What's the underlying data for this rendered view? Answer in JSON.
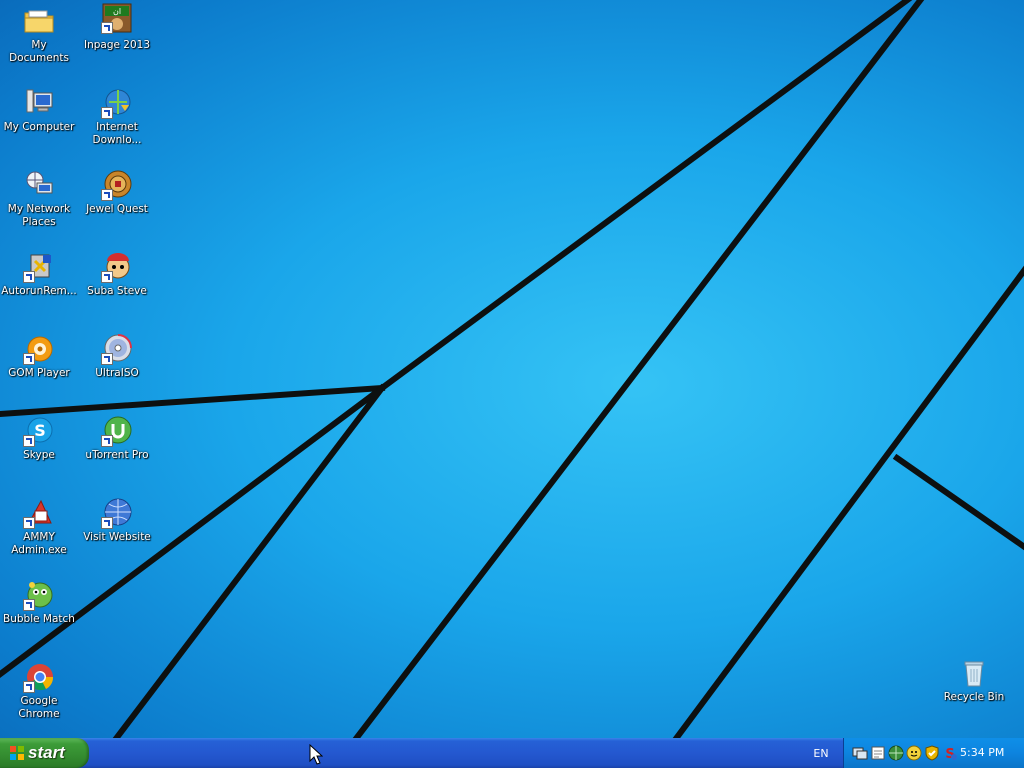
{
  "desktop": {
    "icons": [
      {
        "label": "My Documents",
        "icon": "folder-icon"
      },
      {
        "label": "Inpage 2013",
        "icon": "inpage-icon"
      },
      {
        "label": "My Computer",
        "icon": "computer-icon"
      },
      {
        "label": "Internet Downlo...",
        "icon": "internet-download-manager-icon"
      },
      {
        "label": "My Network Places",
        "icon": "network-places-icon"
      },
      {
        "label": "Jewel Quest",
        "icon": "jewel-quest-icon"
      },
      {
        "label": "AutorunRem...",
        "icon": "autorun-remover-icon"
      },
      {
        "label": "Suba Steve",
        "icon": "suba-steve-icon"
      },
      {
        "label": "GOM Player",
        "icon": "gom-player-icon"
      },
      {
        "label": "UltraISO",
        "icon": "ultraiso-icon"
      },
      {
        "label": "Skype",
        "icon": "skype-icon"
      },
      {
        "label": "uTorrent Pro",
        "icon": "utorrent-icon"
      },
      {
        "label": "AMMY Admin.exe",
        "icon": "ammy-admin-icon"
      },
      {
        "label": "Visit Website",
        "icon": "visit-website-icon"
      },
      {
        "label": "Bubble Match",
        "icon": "bubble-match-icon"
      },
      {
        "label": "Google Chrome",
        "icon": "chrome-icon"
      },
      {
        "label": "Recycle Bin",
        "icon": "recycle-bin-icon"
      }
    ]
  },
  "taskbar": {
    "start_label": "start",
    "language": "EN",
    "clock": "5:34 PM",
    "tray_icons": [
      "network-icon",
      "notes-icon",
      "globe-icon",
      "messenger-icon",
      "shield-icon",
      "antivirus-icon"
    ]
  },
  "colors": {
    "wallpaper": "#1aa6ea",
    "taskbar": "#2458d0",
    "start_button": "#3c9c38",
    "tray": "#0d84df"
  }
}
